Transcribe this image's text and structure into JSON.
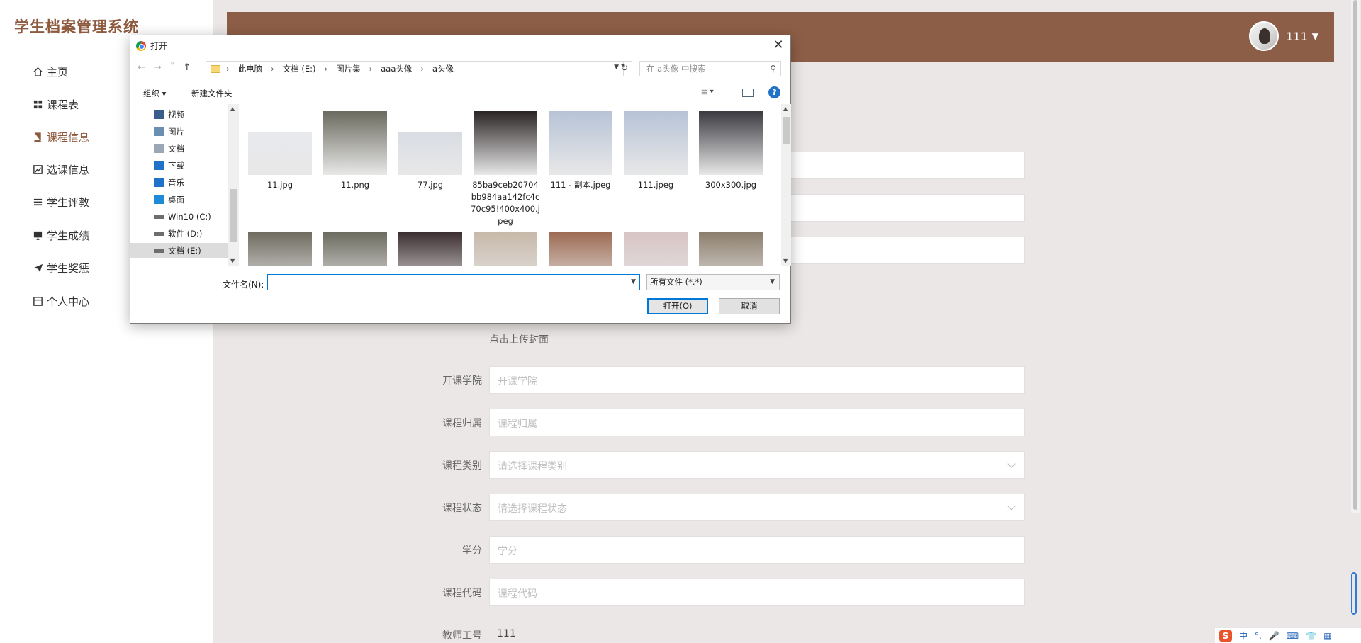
{
  "app": {
    "title": "学生档案管理系统"
  },
  "sidebar": {
    "items": [
      {
        "label": "主页",
        "icon": "home-icon"
      },
      {
        "label": "课程表",
        "icon": "grid-icon"
      },
      {
        "label": "课程信息",
        "icon": "book-icon",
        "active": true
      },
      {
        "label": "选课信息",
        "icon": "chart-icon"
      },
      {
        "label": "学生评教",
        "icon": "list-icon"
      },
      {
        "label": "学生成绩",
        "icon": "monitor-icon"
      },
      {
        "label": "学生奖惩",
        "icon": "send-icon"
      },
      {
        "label": "个人中心",
        "icon": "window-icon"
      }
    ]
  },
  "header": {
    "username": "111"
  },
  "form": {
    "upload_label": "点击上传封面",
    "fields": [
      {
        "label": "开课学院",
        "placeholder": "开课学院",
        "value": ""
      },
      {
        "label": "课程归属",
        "placeholder": "课程归属",
        "value": ""
      },
      {
        "label": "课程类别",
        "placeholder": "请选择课程类别",
        "value": "",
        "type": "select"
      },
      {
        "label": "课程状态",
        "placeholder": "请选择课程状态",
        "value": "",
        "type": "select"
      },
      {
        "label": "学分",
        "placeholder": "学分",
        "value": ""
      },
      {
        "label": "课程代码",
        "placeholder": "课程代码",
        "value": ""
      },
      {
        "label": "教师工号",
        "placeholder": "",
        "value": "111"
      }
    ]
  },
  "dialog": {
    "title": "打开",
    "breadcrumbs": [
      "此电脑",
      "文档 (E:)",
      "图片集",
      "aaa头像",
      "a头像"
    ],
    "search_placeholder": "在 a头像 中搜索",
    "toolbar": {
      "organize": "组织 ▾",
      "new_folder": "新建文件夹"
    },
    "tree": [
      {
        "label": "视频",
        "icon": "video-folder-icon"
      },
      {
        "label": "图片",
        "icon": "pictures-folder-icon"
      },
      {
        "label": "文档",
        "icon": "documents-folder-icon"
      },
      {
        "label": "下载",
        "icon": "download-folder-icon"
      },
      {
        "label": "音乐",
        "icon": "music-folder-icon"
      },
      {
        "label": "桌面",
        "icon": "desktop-folder-icon"
      },
      {
        "label": "Win10 (C:)",
        "icon": "drive-icon"
      },
      {
        "label": "软件 (D:)",
        "icon": "drive-icon"
      },
      {
        "label": "文档 (E:)",
        "icon": "drive-icon",
        "selected": true
      }
    ],
    "files": [
      {
        "name": "11.jpg",
        "color": "#e7e9ed"
      },
      {
        "name": "11.png",
        "color": "#6b6a5e"
      },
      {
        "name": "77.jpg",
        "color": "#d9dde3"
      },
      {
        "name": "85ba9ceb20704bb984aa142fc4c70c95!400x400.jpeg",
        "color": "#2a2424"
      },
      {
        "name": "111 - 副本.jpeg",
        "color": "#b7c3d6"
      },
      {
        "name": "111.jpeg",
        "color": "#b7c3d6"
      },
      {
        "name": "300x300.jpg",
        "color": "#3a3a40"
      },
      {
        "name": "",
        "color": "#6e6a5e"
      },
      {
        "name": "",
        "color": "#6b6a5e"
      },
      {
        "name": "",
        "color": "#3a2c2e"
      },
      {
        "name": "",
        "color": "#c7b8a9"
      },
      {
        "name": "",
        "color": "#9c6a52"
      },
      {
        "name": "",
        "color": "#d7c3c4"
      },
      {
        "name": "",
        "color": "#8b7d6b"
      }
    ],
    "filename_label": "文件名(N):",
    "filename_value": "",
    "filter": "所有文件 (*.*)",
    "open_button": "打开(O)",
    "cancel_button": "取消"
  },
  "tray": {
    "ime": "S",
    "lang": "中",
    "items": [
      "°,",
      "🎤",
      "⌨",
      "👕",
      "▦"
    ]
  }
}
